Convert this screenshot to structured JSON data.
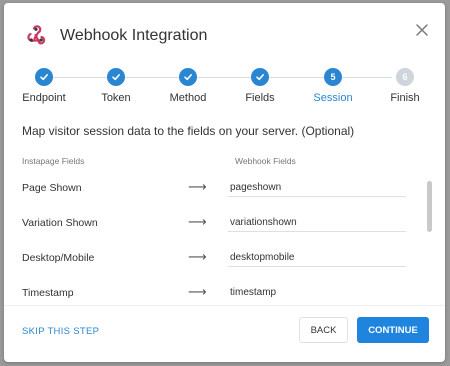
{
  "header": {
    "title": "Webhook Integration",
    "logo_icon": "webhook-logo-icon",
    "close_icon": "close-icon"
  },
  "colors": {
    "accent": "#2b86d1",
    "button_primary": "#1f84de",
    "step_pending": "#cfd5dc",
    "webhook_logo": "#c73a63"
  },
  "steps": [
    {
      "label": "Endpoint",
      "status": "done",
      "marker": "check-icon"
    },
    {
      "label": "Token",
      "status": "done",
      "marker": "check-icon"
    },
    {
      "label": "Method",
      "status": "done",
      "marker": "check-icon"
    },
    {
      "label": "Fields",
      "status": "done",
      "marker": "check-icon"
    },
    {
      "label": "Session",
      "status": "active",
      "number": "5"
    },
    {
      "label": "Finish",
      "status": "pending",
      "number": "6"
    }
  ],
  "intro": "Map visitor session data to the fields on your server. (Optional)",
  "columns": {
    "left": "Instapage Fields",
    "right": "Webhook Fields"
  },
  "rows": [
    {
      "label": "Page Shown",
      "value": "pageshown"
    },
    {
      "label": "Variation Shown",
      "value": "variationshown"
    },
    {
      "label": "Desktop/Mobile",
      "value": "desktopmobile"
    },
    {
      "label": "Timestamp",
      "value": "timestamp"
    }
  ],
  "arrow_glyph": "⟶",
  "footer": {
    "skip_label": "SKIP THIS STEP",
    "back_label": "BACK",
    "continue_label": "CONTINUE"
  }
}
